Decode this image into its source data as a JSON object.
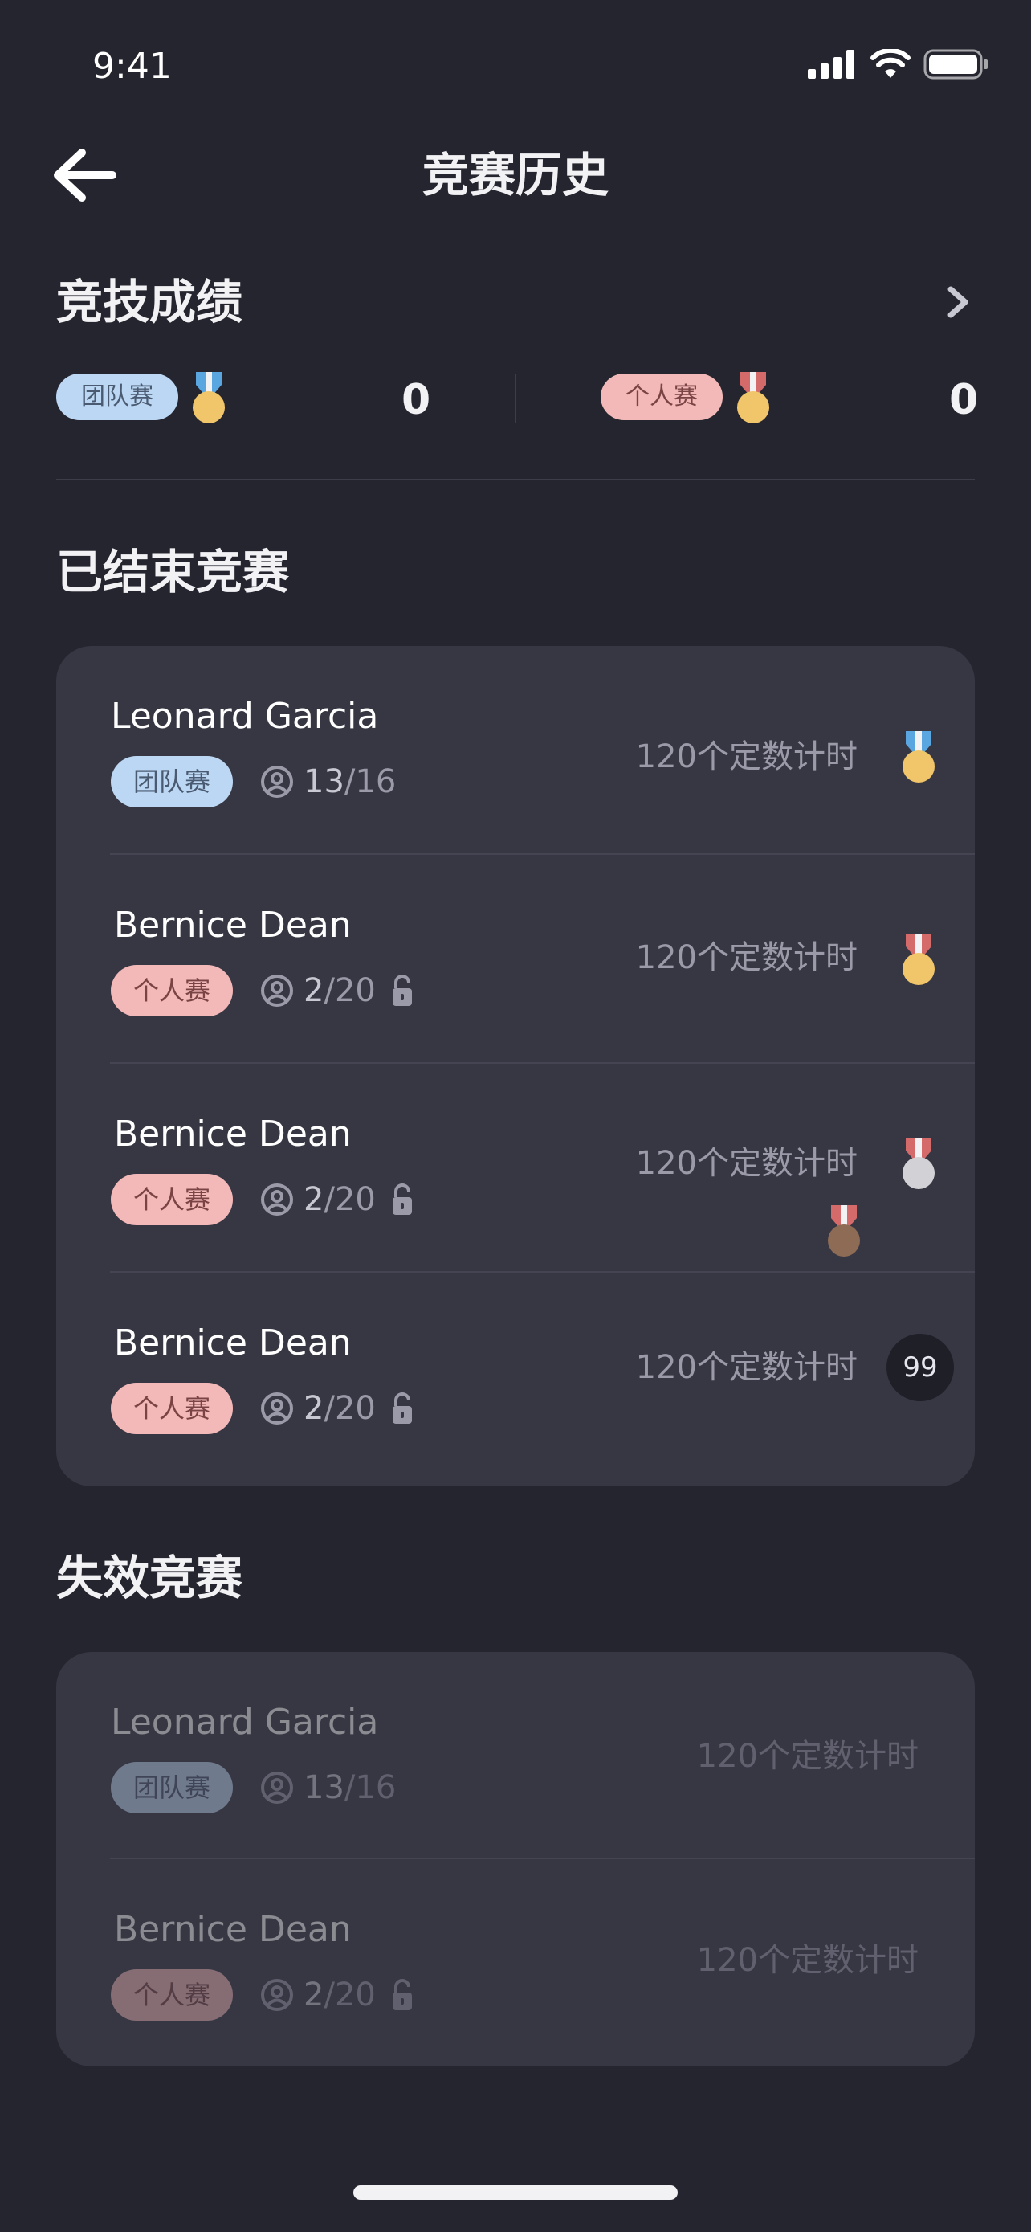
{
  "status": {
    "time": "9:41"
  },
  "header": {
    "title": "竞赛历史"
  },
  "achievements": {
    "title": "竞技成绩",
    "team": {
      "tag": "团队赛",
      "score": "0"
    },
    "individual": {
      "tag": "个人赛",
      "score": "0"
    }
  },
  "finished": {
    "title": "已结束竞赛",
    "items": [
      {
        "name": "Leonard Garcia",
        "tag": "团队赛",
        "joined": "13",
        "total": "16",
        "mode": "120个定数计时",
        "result": "gold-medal"
      },
      {
        "name": "Bernice Dean",
        "tag": "个人赛",
        "joined": "2",
        "total": "20",
        "mode": "120个定数计时",
        "result": "gold-medal"
      },
      {
        "name": "Bernice Dean",
        "tag": "个人赛",
        "joined": "2",
        "total": "20",
        "mode": "120个定数计时",
        "result": "silver-medal"
      },
      {
        "name": "Bernice Dean",
        "tag": "个人赛",
        "joined": "2",
        "total": "20",
        "mode": "120个定数计时",
        "rank": "99"
      }
    ]
  },
  "expired": {
    "title": "失效竞赛",
    "items": [
      {
        "name": "Leonard Garcia",
        "tag": "团队赛",
        "joined": "13",
        "total": "16",
        "mode": "120个定数计时"
      },
      {
        "name": "Bernice Dean",
        "tag": "个人赛",
        "joined": "2",
        "total": "20",
        "mode": "120个定数计时"
      }
    ]
  },
  "colors": {
    "background": "#25252f",
    "card": "#373744",
    "team_tag": "#bcd7f3",
    "individual_tag": "#f3b8b8",
    "gold": "#f1c56a",
    "silver": "#d2d2d6",
    "bronze": "#8e6b55"
  }
}
